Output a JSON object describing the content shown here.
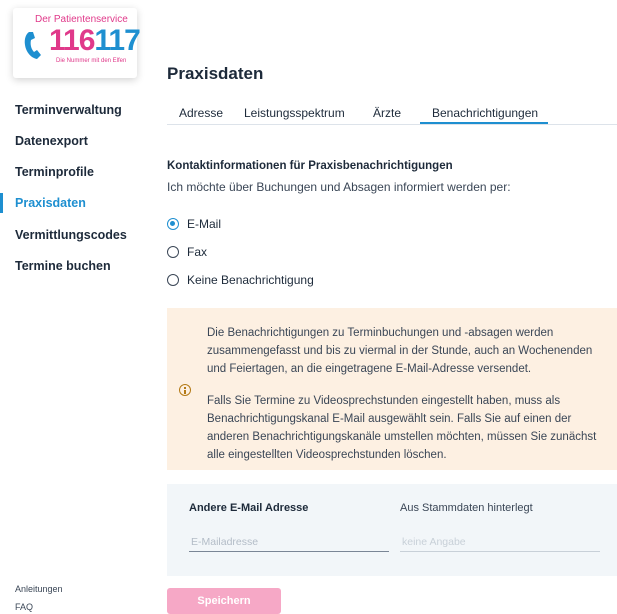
{
  "logo": {
    "top_text": "Der Patientenservice",
    "number_part1": "116",
    "number_part2": "117",
    "subtitle": "Die Nummer mit den Elfen",
    "colors": {
      "pink": "#e0398a",
      "blue": "#1e8fd0"
    },
    "icon": "phone-icon"
  },
  "sidebar": {
    "items": [
      {
        "label": "Terminverwaltung",
        "active": false
      },
      {
        "label": "Datenexport",
        "active": false
      },
      {
        "label": "Terminprofile",
        "active": false
      },
      {
        "label": "Praxisdaten",
        "active": true
      },
      {
        "label": "Vermittlungscodes",
        "active": false
      },
      {
        "label": "Termine buchen",
        "active": false
      }
    ],
    "footer_links": [
      "Anleitungen",
      "FAQ"
    ]
  },
  "page": {
    "title": "Praxisdaten",
    "tabs": [
      {
        "label": "Adresse",
        "active": false
      },
      {
        "label": "Leistungsspektrum",
        "active": false
      },
      {
        "label": "Ärzte",
        "active": false
      },
      {
        "label": "Benachrichtigungen",
        "active": true
      }
    ]
  },
  "notifications": {
    "section_title": "Kontaktinformationen für Praxisbenachrichtigungen",
    "section_desc": "Ich möchte über Buchungen und Absagen informiert werden per:",
    "options": [
      {
        "label": "E-Mail",
        "checked": true
      },
      {
        "label": "Fax",
        "checked": false
      },
      {
        "label": "Keine Benachrichtigung",
        "checked": false
      }
    ],
    "info_icon": "info-icon",
    "info_paragraph1_lines": [
      "Die Benachrichtigungen zu Terminbuchungen und -absagen werden",
      "zusammengefasst und bis zu viermal in der Stunde, auch an Wochenenden",
      "und Feiertagen, an die eingetragene E-Mail-Adresse versendet."
    ],
    "info_paragraph2_lines": [
      "Falls Sie Termine zu Videosprechstunden eingestellt haben, muss als",
      "Benachrichtigungskanal E-Mail ausgewählt sein. Falls Sie auf einen der",
      "anderen Benachrichtigungskanäle umstellen möchten, müssen Sie zunächst",
      "alle eingestellten Videosprechstunden löschen."
    ]
  },
  "email_panel": {
    "left_heading": "Andere E-Mail Adresse",
    "right_heading": "Aus Stammdaten hinterlegt",
    "email_placeholder": "E-Mailadresse",
    "stammdaten_value": "keine Angabe"
  },
  "actions": {
    "save_label": "Speichern"
  },
  "colors": {
    "accent": "#1e8fd0",
    "info_bg": "#fdf0e2",
    "save_button": "#f6a8c6",
    "panel_bg": "#f2f6f9"
  }
}
